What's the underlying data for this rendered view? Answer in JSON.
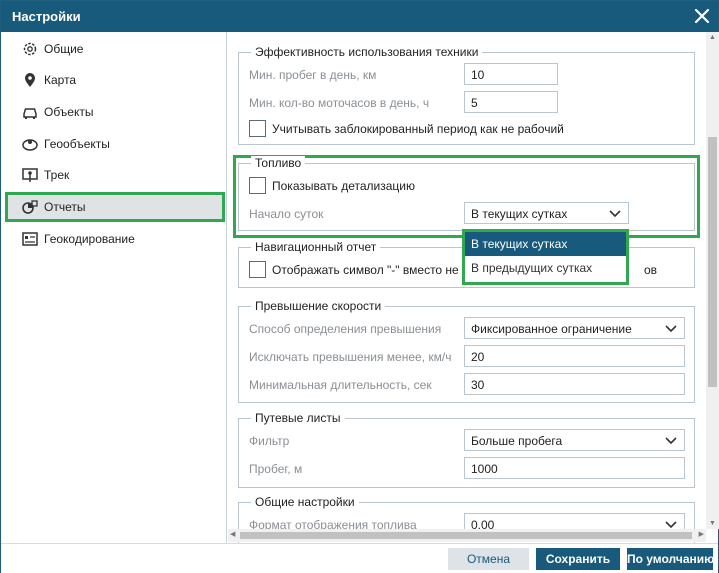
{
  "dialog": {
    "title": "Настройки"
  },
  "sidebar": {
    "items": [
      {
        "label": "Общие",
        "icon": "gear-icon"
      },
      {
        "label": "Карта",
        "icon": "map-pin-icon"
      },
      {
        "label": "Объекты",
        "icon": "car-icon"
      },
      {
        "label": "Геообъекты",
        "icon": "geofence-icon"
      },
      {
        "label": "Трек",
        "icon": "track-icon"
      },
      {
        "label": "Отчеты",
        "icon": "reports-icon",
        "active": true
      },
      {
        "label": "Геокодирование",
        "icon": "geocoding-icon"
      }
    ]
  },
  "efficiency": {
    "legend": "Эффективность использования техники",
    "min_mileage_label": "Мин. пробег в день, км",
    "min_mileage_value": "10",
    "min_hours_label": "Мин. кол-во моточасов в день, ч",
    "min_hours_value": "5",
    "blocked_period_label": "Учитывать заблокированный период как не рабочий"
  },
  "fuel": {
    "legend": "Топливо",
    "show_detail_label": "Показывать детализацию",
    "day_start_label": "Начало суток",
    "day_start_value": "В текущих сутках",
    "options": [
      "В текущих сутках",
      "В предыдущих сутках"
    ]
  },
  "nav_report": {
    "legend": "Навигационный отчет",
    "symbol_label_start": "Отображать символ \"-\" вместо не",
    "symbol_label_end": "ов"
  },
  "speeding": {
    "legend": "Превышение скорости",
    "method_label": "Способ определения превышения",
    "method_value": "Фиксированное ограничение",
    "exclude_label": "Исключать превышения менее, км/ч",
    "exclude_value": "20",
    "min_duration_label": "Минимальная длительность, сек",
    "min_duration_value": "30"
  },
  "waybills": {
    "legend": "Путевые листы",
    "filter_label": "Фильтр",
    "filter_value": "Больше пробега",
    "mileage_label": "Пробег, м",
    "mileage_value": "1000"
  },
  "general": {
    "legend": "Общие настройки",
    "fuel_format_label": "Формат отображения топлива",
    "fuel_format_value": "0.00"
  },
  "footer": {
    "cancel_label": "Отмена",
    "save_label": "Сохранить",
    "default_label": "По умолчанию"
  },
  "colors": {
    "titlebar": "#185a7c",
    "highlight": "#2fa84f",
    "selected_option": "#185a7c"
  }
}
